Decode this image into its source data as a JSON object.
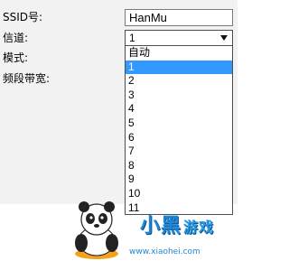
{
  "form": {
    "ssid_label": "SSID号:",
    "channel_label": "信道:",
    "mode_label": "模式:",
    "bandwidth_label": "频段带宽:",
    "ssid_value": "HanMu",
    "channel_selected": "1"
  },
  "channel_options": [
    "自动",
    "1",
    "2",
    "3",
    "4",
    "5",
    "6",
    "7",
    "8",
    "9",
    "10",
    "11"
  ],
  "highlight_color": "#3399ff",
  "watermark": {
    "logo_main": "小黑",
    "logo_sub": "游戏",
    "url": "www.xiaohei.com"
  }
}
